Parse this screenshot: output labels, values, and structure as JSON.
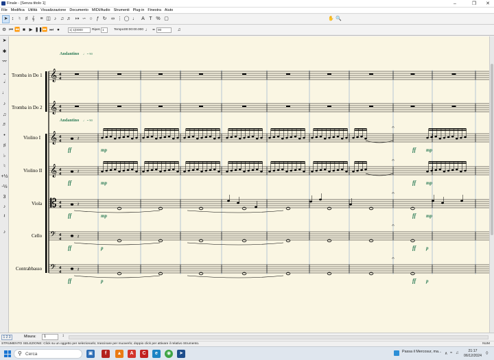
{
  "window": {
    "title": "Finale - [Senza titolo 1]"
  },
  "menu": [
    "File",
    "Modifica",
    "Utilità",
    "Visualizzazione",
    "Documento",
    "MIDI/Audio",
    "Strumenti",
    "Plug-in",
    "Finestra",
    "Aiuto"
  ],
  "playback": {
    "counter": "1| 1|0000",
    "repeat_label": "Ripet.:",
    "repeat_value": "1",
    "tempo_label": "Tempo:",
    "tempo_value": "00:00:00.000",
    "bpm_value": "90"
  },
  "score": {
    "tempo_text": "Andantino",
    "metronome": "= 90",
    "instruments": [
      "Tromba in Do 1",
      "Tromba in Do 2",
      "Violino I",
      "Violino II",
      "Viola",
      "Cello",
      "Contrabbasso"
    ],
    "dynamics_ff": "ff",
    "dynamics_mp": "mp",
    "dynamics_p": "p"
  },
  "bottom": {
    "measure_label": "Misura:",
    "measure_value": "1"
  },
  "status": {
    "text": "STRUMENTO SELEZIONE: Click su un oggetto per selezionarlo; trascinare per muoverlo; doppio click per attivare il relativo Strumento.",
    "mode": "NUM"
  },
  "taskbar": {
    "search_placeholder": "Cerca",
    "news": "Passa il Mercosur, ma...",
    "time": "21:17",
    "date": "06/12/2024"
  },
  "colors": {
    "accent": "#1975d2",
    "dynamics": "#2a7a55",
    "score_bg": "#faf6e3",
    "measure_guides": "#6f93c4"
  }
}
